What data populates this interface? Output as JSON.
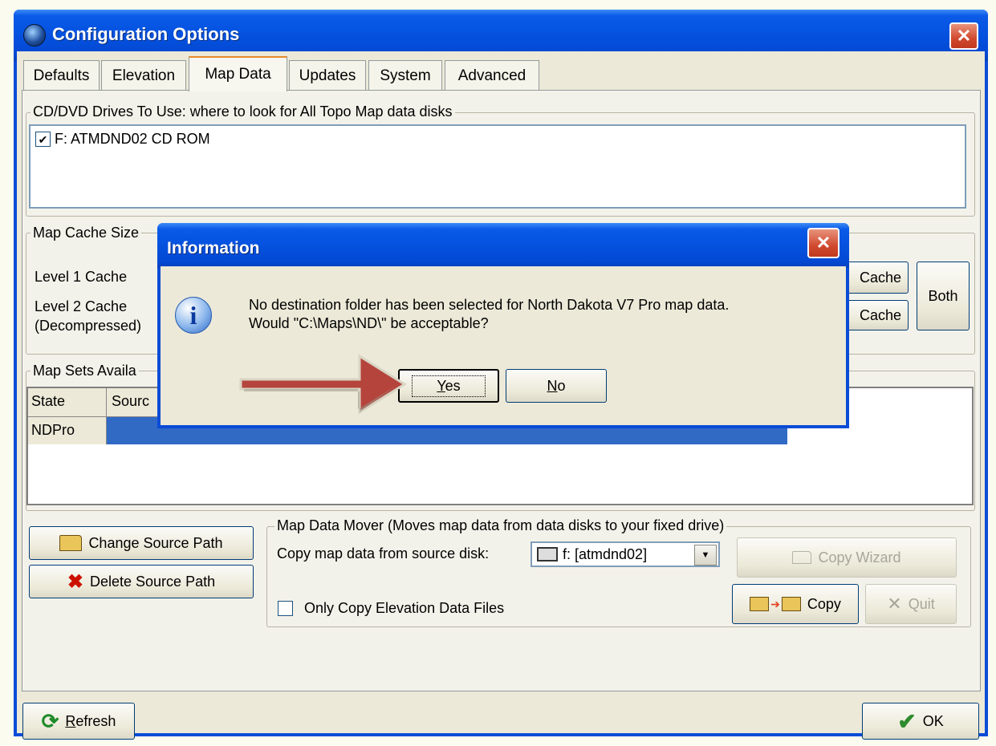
{
  "window": {
    "title": "Configuration Options",
    "close_glyph": "✕"
  },
  "tabs": [
    {
      "label": "Defaults",
      "active": false
    },
    {
      "label": "Elevation",
      "active": false
    },
    {
      "label": "Map Data",
      "active": true
    },
    {
      "label": "Updates",
      "active": false
    },
    {
      "label": "System",
      "active": false
    },
    {
      "label": "Advanced",
      "active": false
    }
  ],
  "drives_group": {
    "legend": "CD/DVD Drives To Use:  where to look for All Topo Map data disks",
    "items": [
      {
        "label": "F: ATMDND02 CD ROM",
        "checked": true,
        "check_glyph": "✔"
      }
    ]
  },
  "cache_group": {
    "legend": "Map Cache Size",
    "level1_label": "Level 1 Cache",
    "level2_label": "Level 2 Cache",
    "level2_sub": "(Decompressed)",
    "clear_cache_1": "Cache",
    "clear_cache_2": "Cache",
    "both_button": "Both"
  },
  "mapsets_group": {
    "legend": "Map Sets Availa",
    "columns": [
      "State",
      "Sourc"
    ],
    "rows": [
      {
        "state": "NDPro"
      }
    ]
  },
  "source_buttons": {
    "change": "Change Source Path",
    "delete": "Delete Source Path"
  },
  "mover_group": {
    "legend": "Map Data Mover (Moves map data from data disks to your fixed drive)",
    "copy_from_label": "Copy map data from source disk:",
    "source_disk": "f: [atmdnd02]",
    "copy_wizard": "Copy Wizard",
    "copy": "Copy",
    "quit": "Quit",
    "elevation_only_label": "Only Copy Elevation Data Files"
  },
  "footer": {
    "refresh_underlined": "R",
    "refresh_rest": "efresh",
    "ok": "OK"
  },
  "dialog": {
    "title": "Information",
    "message_line1": "No destination folder has been selected for North Dakota V7 Pro map data.",
    "message_line2": "Would \"C:\\Maps\\ND\\\" be acceptable?",
    "yes_underlined": "Y",
    "yes_rest": "es",
    "no_underlined": "N",
    "no_rest": "o",
    "close_glyph": "✕",
    "icon_glyph": "i"
  },
  "colors": {
    "titlebar_blue": "#0553e0",
    "dialog_face": "#ece9d8",
    "selection_blue": "#316ac5",
    "arrow_red": "#b5443c",
    "close_red": "#d14a2f",
    "ok_check_green": "#2e8b2e",
    "delete_x_red": "#cc1100"
  }
}
